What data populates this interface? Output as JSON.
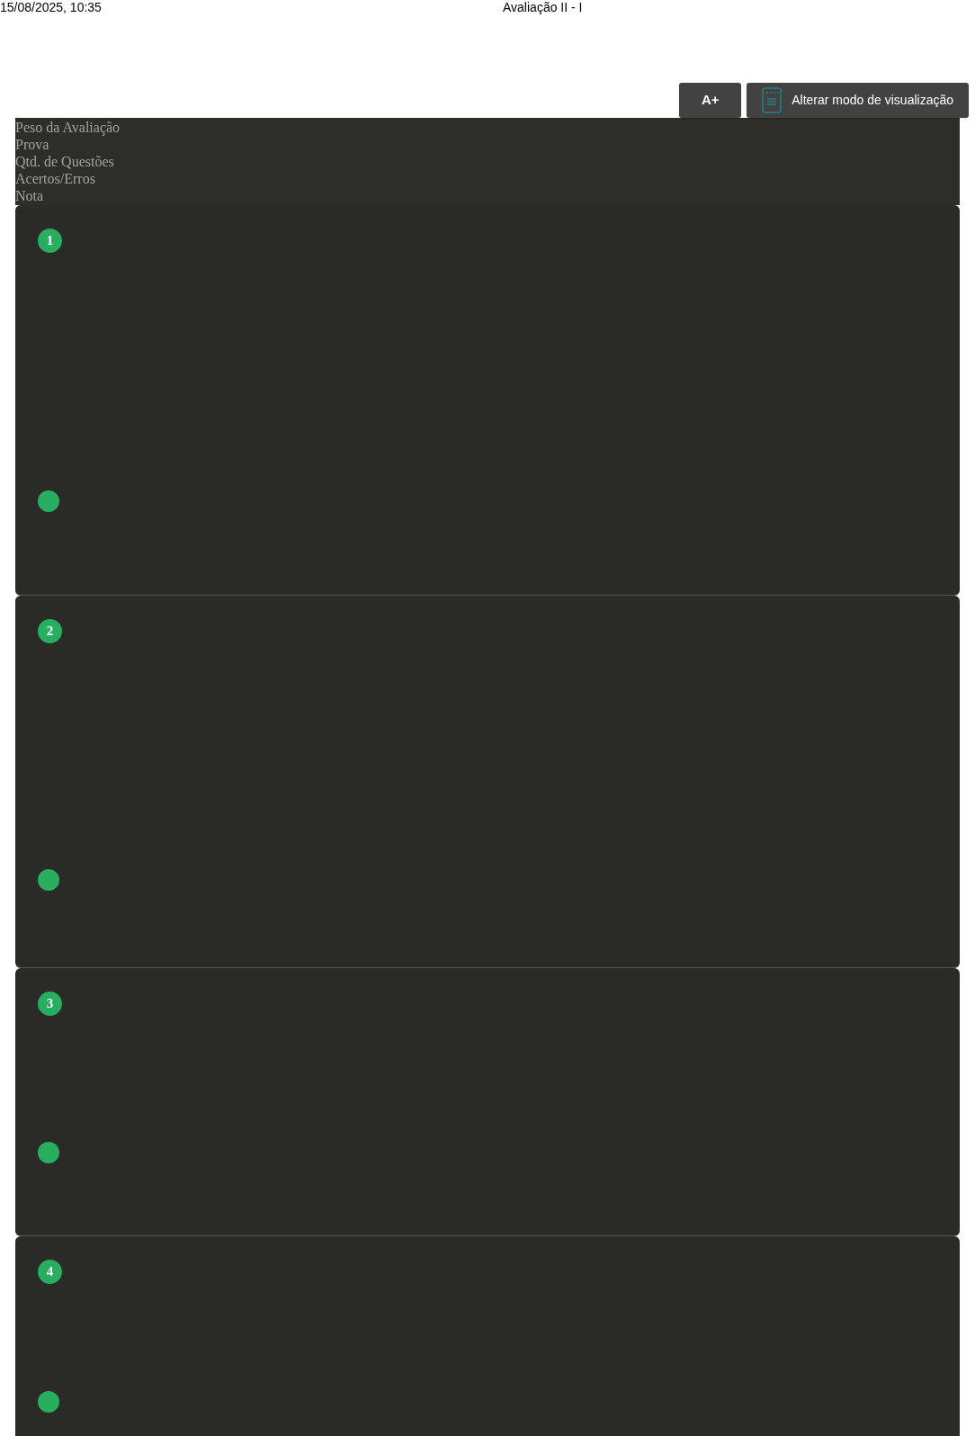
{
  "print_header": {
    "datetime": "15/08/2025, 10:35",
    "title": "Avaliação II - I"
  },
  "toolbar": [
    {
      "kind": "text",
      "label": "A+"
    },
    {
      "kind": "icon",
      "label": "Alterar modo de visualização"
    }
  ],
  "summary": [
    "Peso da Avaliação",
    "Prova",
    "Qtd. de Questões",
    "Acertos/Erros",
    "Nota"
  ],
  "questions": [
    {
      "number": "1"
    },
    {
      "number": "2"
    },
    {
      "number": "3"
    },
    {
      "number": "4"
    }
  ]
}
